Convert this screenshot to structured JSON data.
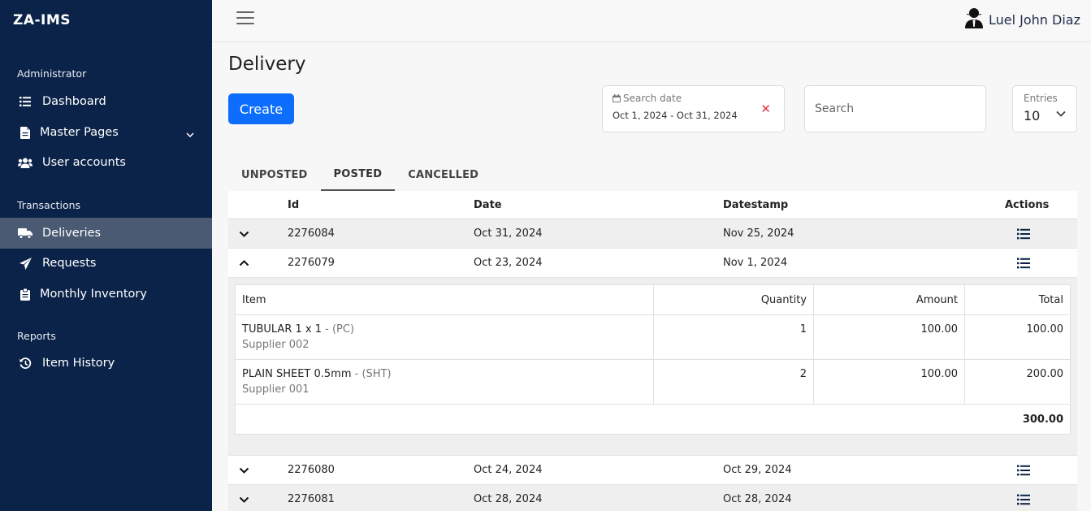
{
  "brand": "ZA-IMS",
  "sidebar": {
    "sections": [
      {
        "title": "Administrator",
        "items": [
          {
            "label": "Dashboard",
            "icon": "list-icon"
          },
          {
            "label": "Master Pages",
            "icon": "file-icon"
          },
          {
            "label": "User accounts",
            "icon": "users-icon"
          }
        ]
      },
      {
        "title": "Transactions",
        "items": [
          {
            "label": "Deliveries",
            "icon": "truck-icon"
          },
          {
            "label": "Requests",
            "icon": "paper-plane-icon"
          },
          {
            "label": "Monthly Inventory",
            "icon": "clipboard-icon"
          }
        ]
      },
      {
        "title": "Reports",
        "items": [
          {
            "label": "Item History",
            "icon": "history-icon"
          }
        ]
      }
    ]
  },
  "topbar": {
    "user_name": "Luel John Diaz"
  },
  "page": {
    "title": "Delivery",
    "create_label": "Create",
    "date_filter": {
      "label": "Search date",
      "value": "Oct 1, 2024 - Oct 31, 2024"
    },
    "search": {
      "placeholder": "Search"
    },
    "entries": {
      "label": "Entries",
      "value": "10"
    }
  },
  "tabs": [
    "UNPOSTED",
    "POSTED",
    "CANCELLED"
  ],
  "table": {
    "headers": {
      "id": "Id",
      "date": "Date",
      "datestamp": "Datestamp",
      "actions": "Actions"
    },
    "rows": [
      {
        "id": "2276084",
        "date": "Oct 31, 2024",
        "datestamp": "Nov 25, 2024"
      },
      {
        "id": "2276079",
        "date": "Oct 23, 2024",
        "datestamp": "Nov 1, 2024"
      },
      {
        "id": "2276080",
        "date": "Oct 24, 2024",
        "datestamp": "Oct 29, 2024"
      },
      {
        "id": "2276081",
        "date": "Oct 28, 2024",
        "datestamp": "Oct 28, 2024"
      }
    ]
  },
  "detail": {
    "headers": {
      "item": "Item",
      "quantity": "Quantity",
      "amount": "Amount",
      "total": "Total"
    },
    "items": [
      {
        "name": "TUBULAR 1 x 1",
        "unit": "- (PC)",
        "supplier": "Supplier 002",
        "quantity": "1",
        "amount": "100.00",
        "total": "100.00"
      },
      {
        "name": "PLAIN SHEET 0.5mm",
        "unit": "- (SHT)",
        "supplier": "Supplier 001",
        "quantity": "2",
        "amount": "100.00",
        "total": "200.00"
      }
    ],
    "grand_total": "300.00"
  },
  "colors": {
    "sidebar": "#0b2349",
    "active_nav": "#4a5a73",
    "primary": "#0d6efd",
    "danger": "#dc3545"
  }
}
